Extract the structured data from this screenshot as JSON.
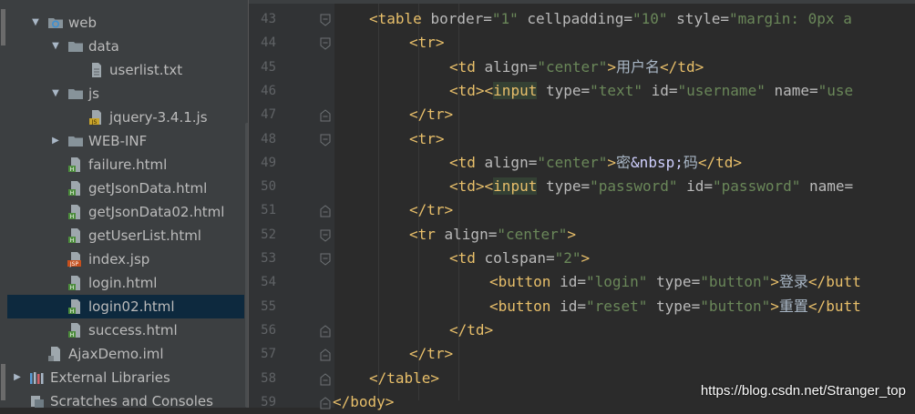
{
  "project_tree": [
    {
      "label": "web",
      "type": "folder-web",
      "expanded": true,
      "depth": 1
    },
    {
      "label": "data",
      "type": "folder",
      "expanded": true,
      "depth": 2
    },
    {
      "label": "userlist.txt",
      "type": "file-txt",
      "depth": 3
    },
    {
      "label": "js",
      "type": "folder",
      "expanded": true,
      "depth": 2
    },
    {
      "label": "jquery-3.4.1.js",
      "type": "file-js",
      "depth": 3
    },
    {
      "label": "WEB-INF",
      "type": "folder",
      "expanded": false,
      "depth": 2
    },
    {
      "label": "failure.html",
      "type": "file-html",
      "depth": 2
    },
    {
      "label": "getJsonData.html",
      "type": "file-html",
      "depth": 2
    },
    {
      "label": "getJsonData02.html",
      "type": "file-html",
      "depth": 2
    },
    {
      "label": "getUserList.html",
      "type": "file-html",
      "depth": 2
    },
    {
      "label": "index.jsp",
      "type": "file-jsp",
      "depth": 2
    },
    {
      "label": "login.html",
      "type": "file-html",
      "depth": 2
    },
    {
      "label": "login02.html",
      "type": "file-html",
      "depth": 2,
      "selected": true
    },
    {
      "label": "success.html",
      "type": "file-html",
      "depth": 2
    },
    {
      "label": "AjaxDemo.iml",
      "type": "file-iml",
      "depth": 1
    },
    {
      "label": "External Libraries",
      "type": "libraries",
      "expanded": false,
      "depth": 0
    },
    {
      "label": "Scratches and Consoles",
      "type": "scratches",
      "depth": 0
    }
  ],
  "editor": {
    "line_numbers": [
      "43",
      "44",
      "45",
      "46",
      "47",
      "48",
      "49",
      "50",
      "51",
      "52",
      "53",
      "54",
      "55",
      "56",
      "57",
      "58",
      "59"
    ],
    "lines": [
      [
        {
          "t": "tag",
          "v": "<table "
        },
        {
          "t": "attr",
          "v": "border="
        },
        {
          "t": "str",
          "v": "\"1\" "
        },
        {
          "t": "attr",
          "v": "cellpadding="
        },
        {
          "t": "str",
          "v": "\"10\" "
        },
        {
          "t": "attr",
          "v": "style="
        },
        {
          "t": "str",
          "v": "\"margin: 0px a"
        }
      ],
      [
        {
          "t": "tag",
          "v": "<tr>"
        }
      ],
      [
        {
          "t": "tag",
          "v": "<td "
        },
        {
          "t": "attr",
          "v": "align="
        },
        {
          "t": "str",
          "v": "\"center\""
        },
        {
          "t": "tag",
          "v": ">"
        },
        {
          "t": "txt",
          "v": "用户名"
        },
        {
          "t": "tag",
          "v": "</td>"
        }
      ],
      [
        {
          "t": "tag",
          "v": "<td><"
        },
        {
          "t": "tag-hl",
          "v": "input"
        },
        {
          "t": "tag",
          "v": " "
        },
        {
          "t": "attr",
          "v": "type="
        },
        {
          "t": "str",
          "v": "\"text\" "
        },
        {
          "t": "attr",
          "v": "id="
        },
        {
          "t": "str",
          "v": "\"username\" "
        },
        {
          "t": "attr",
          "v": "name="
        },
        {
          "t": "str",
          "v": "\"use"
        }
      ],
      [
        {
          "t": "tag",
          "v": "</tr>"
        }
      ],
      [
        {
          "t": "tag",
          "v": "<tr>"
        }
      ],
      [
        {
          "t": "tag",
          "v": "<td "
        },
        {
          "t": "attr",
          "v": "align="
        },
        {
          "t": "str",
          "v": "\"center\""
        },
        {
          "t": "tag",
          "v": ">"
        },
        {
          "t": "txt",
          "v": "密"
        },
        {
          "t": "ent",
          "v": "&nbsp;"
        },
        {
          "t": "txt",
          "v": "码"
        },
        {
          "t": "tag",
          "v": "</td>"
        }
      ],
      [
        {
          "t": "tag",
          "v": "<td><"
        },
        {
          "t": "tag-hl",
          "v": "input"
        },
        {
          "t": "tag",
          "v": " "
        },
        {
          "t": "attr",
          "v": "type="
        },
        {
          "t": "str",
          "v": "\"password\" "
        },
        {
          "t": "attr",
          "v": "id="
        },
        {
          "t": "str",
          "v": "\"password\" "
        },
        {
          "t": "attr",
          "v": "name="
        }
      ],
      [
        {
          "t": "tag",
          "v": "</tr>"
        }
      ],
      [
        {
          "t": "tag",
          "v": "<tr "
        },
        {
          "t": "attr",
          "v": "align="
        },
        {
          "t": "str",
          "v": "\"center\""
        },
        {
          "t": "tag",
          "v": ">"
        }
      ],
      [
        {
          "t": "tag",
          "v": "<td "
        },
        {
          "t": "attr",
          "v": "colspan="
        },
        {
          "t": "str",
          "v": "\"2\""
        },
        {
          "t": "tag",
          "v": ">"
        }
      ],
      [
        {
          "t": "tag",
          "v": "<button "
        },
        {
          "t": "attr",
          "v": "id="
        },
        {
          "t": "str",
          "v": "\"login\" "
        },
        {
          "t": "attr",
          "v": "type="
        },
        {
          "t": "str",
          "v": "\"button\""
        },
        {
          "t": "tag",
          "v": ">"
        },
        {
          "t": "txt",
          "v": "登录"
        },
        {
          "t": "tag",
          "v": "</butt"
        }
      ],
      [
        {
          "t": "tag",
          "v": "<button "
        },
        {
          "t": "attr",
          "v": "id="
        },
        {
          "t": "str",
          "v": "\"reset\" "
        },
        {
          "t": "attr",
          "v": "type="
        },
        {
          "t": "str",
          "v": "\"button\""
        },
        {
          "t": "tag",
          "v": ">"
        },
        {
          "t": "txt",
          "v": "重置"
        },
        {
          "t": "tag",
          "v": "</butt"
        }
      ],
      [
        {
          "t": "tag",
          "v": "</td>"
        }
      ],
      [
        {
          "t": "tag",
          "v": "</tr>"
        }
      ],
      [
        {
          "t": "tag",
          "v": "</table>"
        }
      ],
      [
        {
          "t": "tag",
          "v": "</body>"
        }
      ]
    ]
  },
  "watermark": "https://blog.csdn.net/Stranger_top",
  "colors": {
    "background": "#2b2b2b",
    "panel": "#3c3f41",
    "selection": "#0d293e",
    "tag": "#e8bf6a",
    "attribute": "#bababa",
    "string": "#6a8759",
    "text": "#a9b7c6"
  }
}
